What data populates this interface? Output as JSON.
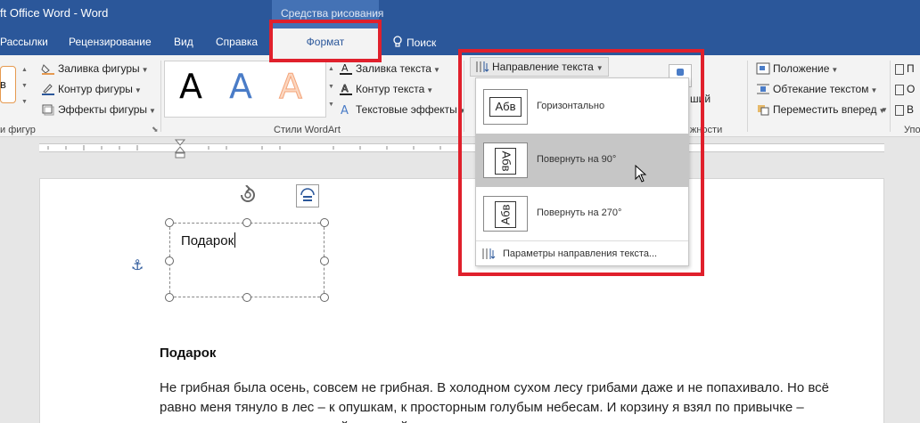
{
  "titlebar": {
    "title": "ft Office Word  -  Word",
    "context_group": "Средства рисования"
  },
  "tabs": {
    "items": [
      "Рассылки",
      "Рецензирование",
      "Вид",
      "Справка"
    ],
    "active": "Формат",
    "search": "Поиск"
  },
  "ribbon": {
    "shape_fill": "Заливка фигуры",
    "shape_outline": "Контур фигуры",
    "shape_effects": "Эффекты фигуры",
    "group_shapes": "и фигур",
    "wordart_letter": "A",
    "group_wordart": "Стили WordArt",
    "text_fill": "Заливка текста",
    "text_outline": "Контур текста",
    "text_effects": "Текстовые эффекты",
    "text_direction": "Направление текста",
    "position": "Положение",
    "wrap_text": "Обтекание текстом",
    "bring_forward": "Переместить вперед",
    "partial_shi": "ший",
    "partial_vozm": "жности",
    "partial_upo": "Упо",
    "partial_p": "П",
    "partial_o": "О",
    "partial_v": "В",
    "left_box": "в"
  },
  "menu": {
    "sample_text": "Абв",
    "items": [
      {
        "label": "Горизонтально",
        "hover": false
      },
      {
        "label": "Повернуть на 90°",
        "hover": true
      },
      {
        "label": "Повернуть на 270°",
        "hover": false
      }
    ],
    "footer": "Параметры направления текста..."
  },
  "document": {
    "textbox_text": "Подарок",
    "heading": "Подарок",
    "paragraph": "Не грибная была осень, совсем не грибная. В холодном сухом лесу грибами даже и не попахивало. Но всё равно меня тянуло в лес – к опушкам, к просторным голубым небесам. И корзину я взял по привычке – прихватить где-то интересный, похожий на человечка или"
  },
  "colors": {
    "title_blue": "#2b579a",
    "highlight_red": "#e0202c",
    "wordart_black": "#000000",
    "wordart_blue": "#4a7cc7",
    "wordart_orange": "#f4a47a"
  }
}
